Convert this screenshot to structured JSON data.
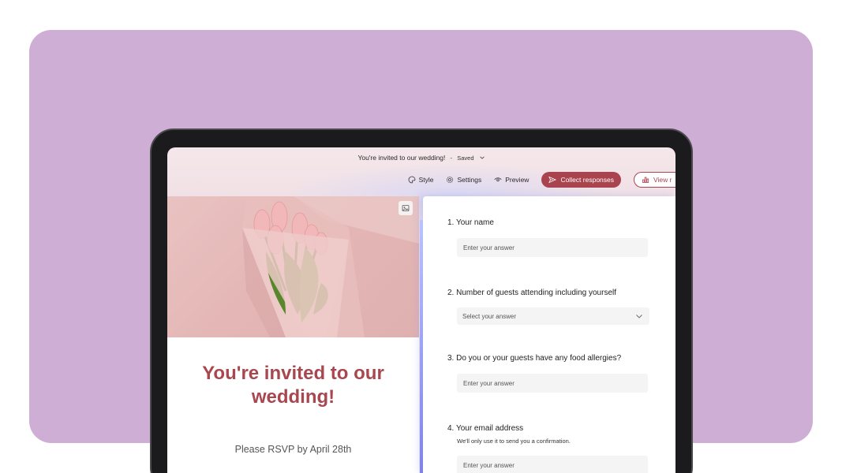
{
  "window": {
    "title": "You're invited to our wedding!",
    "separator": "-",
    "status": "Saved"
  },
  "toolbar": {
    "style": "Style",
    "settings": "Settings",
    "preview": "Preview",
    "collect": "Collect responses",
    "view": "View r"
  },
  "hero": {
    "heading": "You're invited to our wedding!",
    "rsvp": "Please RSVP by April 28th"
  },
  "questions": [
    {
      "label": "1. Your name",
      "placeholder": "Enter your answer"
    },
    {
      "label": "2. Number of guests attending including yourself",
      "placeholder": "Select your answer"
    },
    {
      "label": "3. Do you or your guests have any food allergies?",
      "placeholder": "Enter your answer"
    },
    {
      "label": "4. Your email address",
      "subtitle": "We'll only use it to send you a confirmation.",
      "placeholder": "Enter your answer"
    }
  ],
  "colors": {
    "accent": "#a9434d",
    "background_panel": "#cfaed6"
  }
}
